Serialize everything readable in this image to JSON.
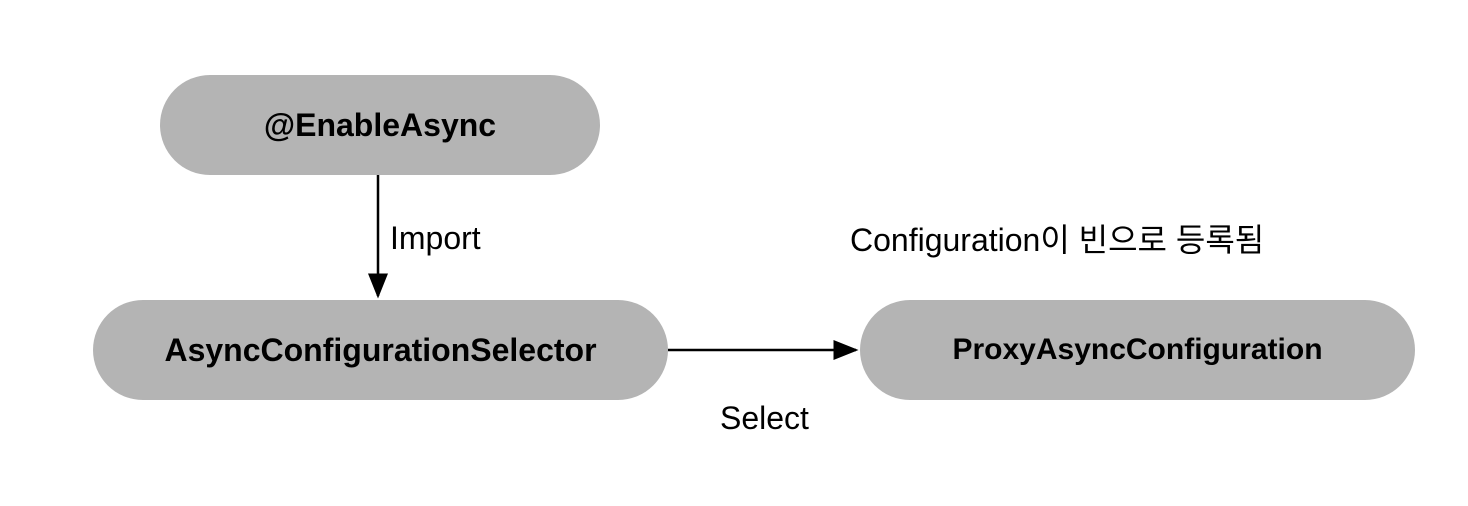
{
  "nodes": {
    "enableAsync": "@EnableAsync",
    "selector": "AsyncConfigurationSelector",
    "proxy": "ProxyAsyncConfiguration"
  },
  "labels": {
    "import": "Import",
    "select": "Select",
    "configNote": "Configuration이 빈으로 등록됨"
  }
}
